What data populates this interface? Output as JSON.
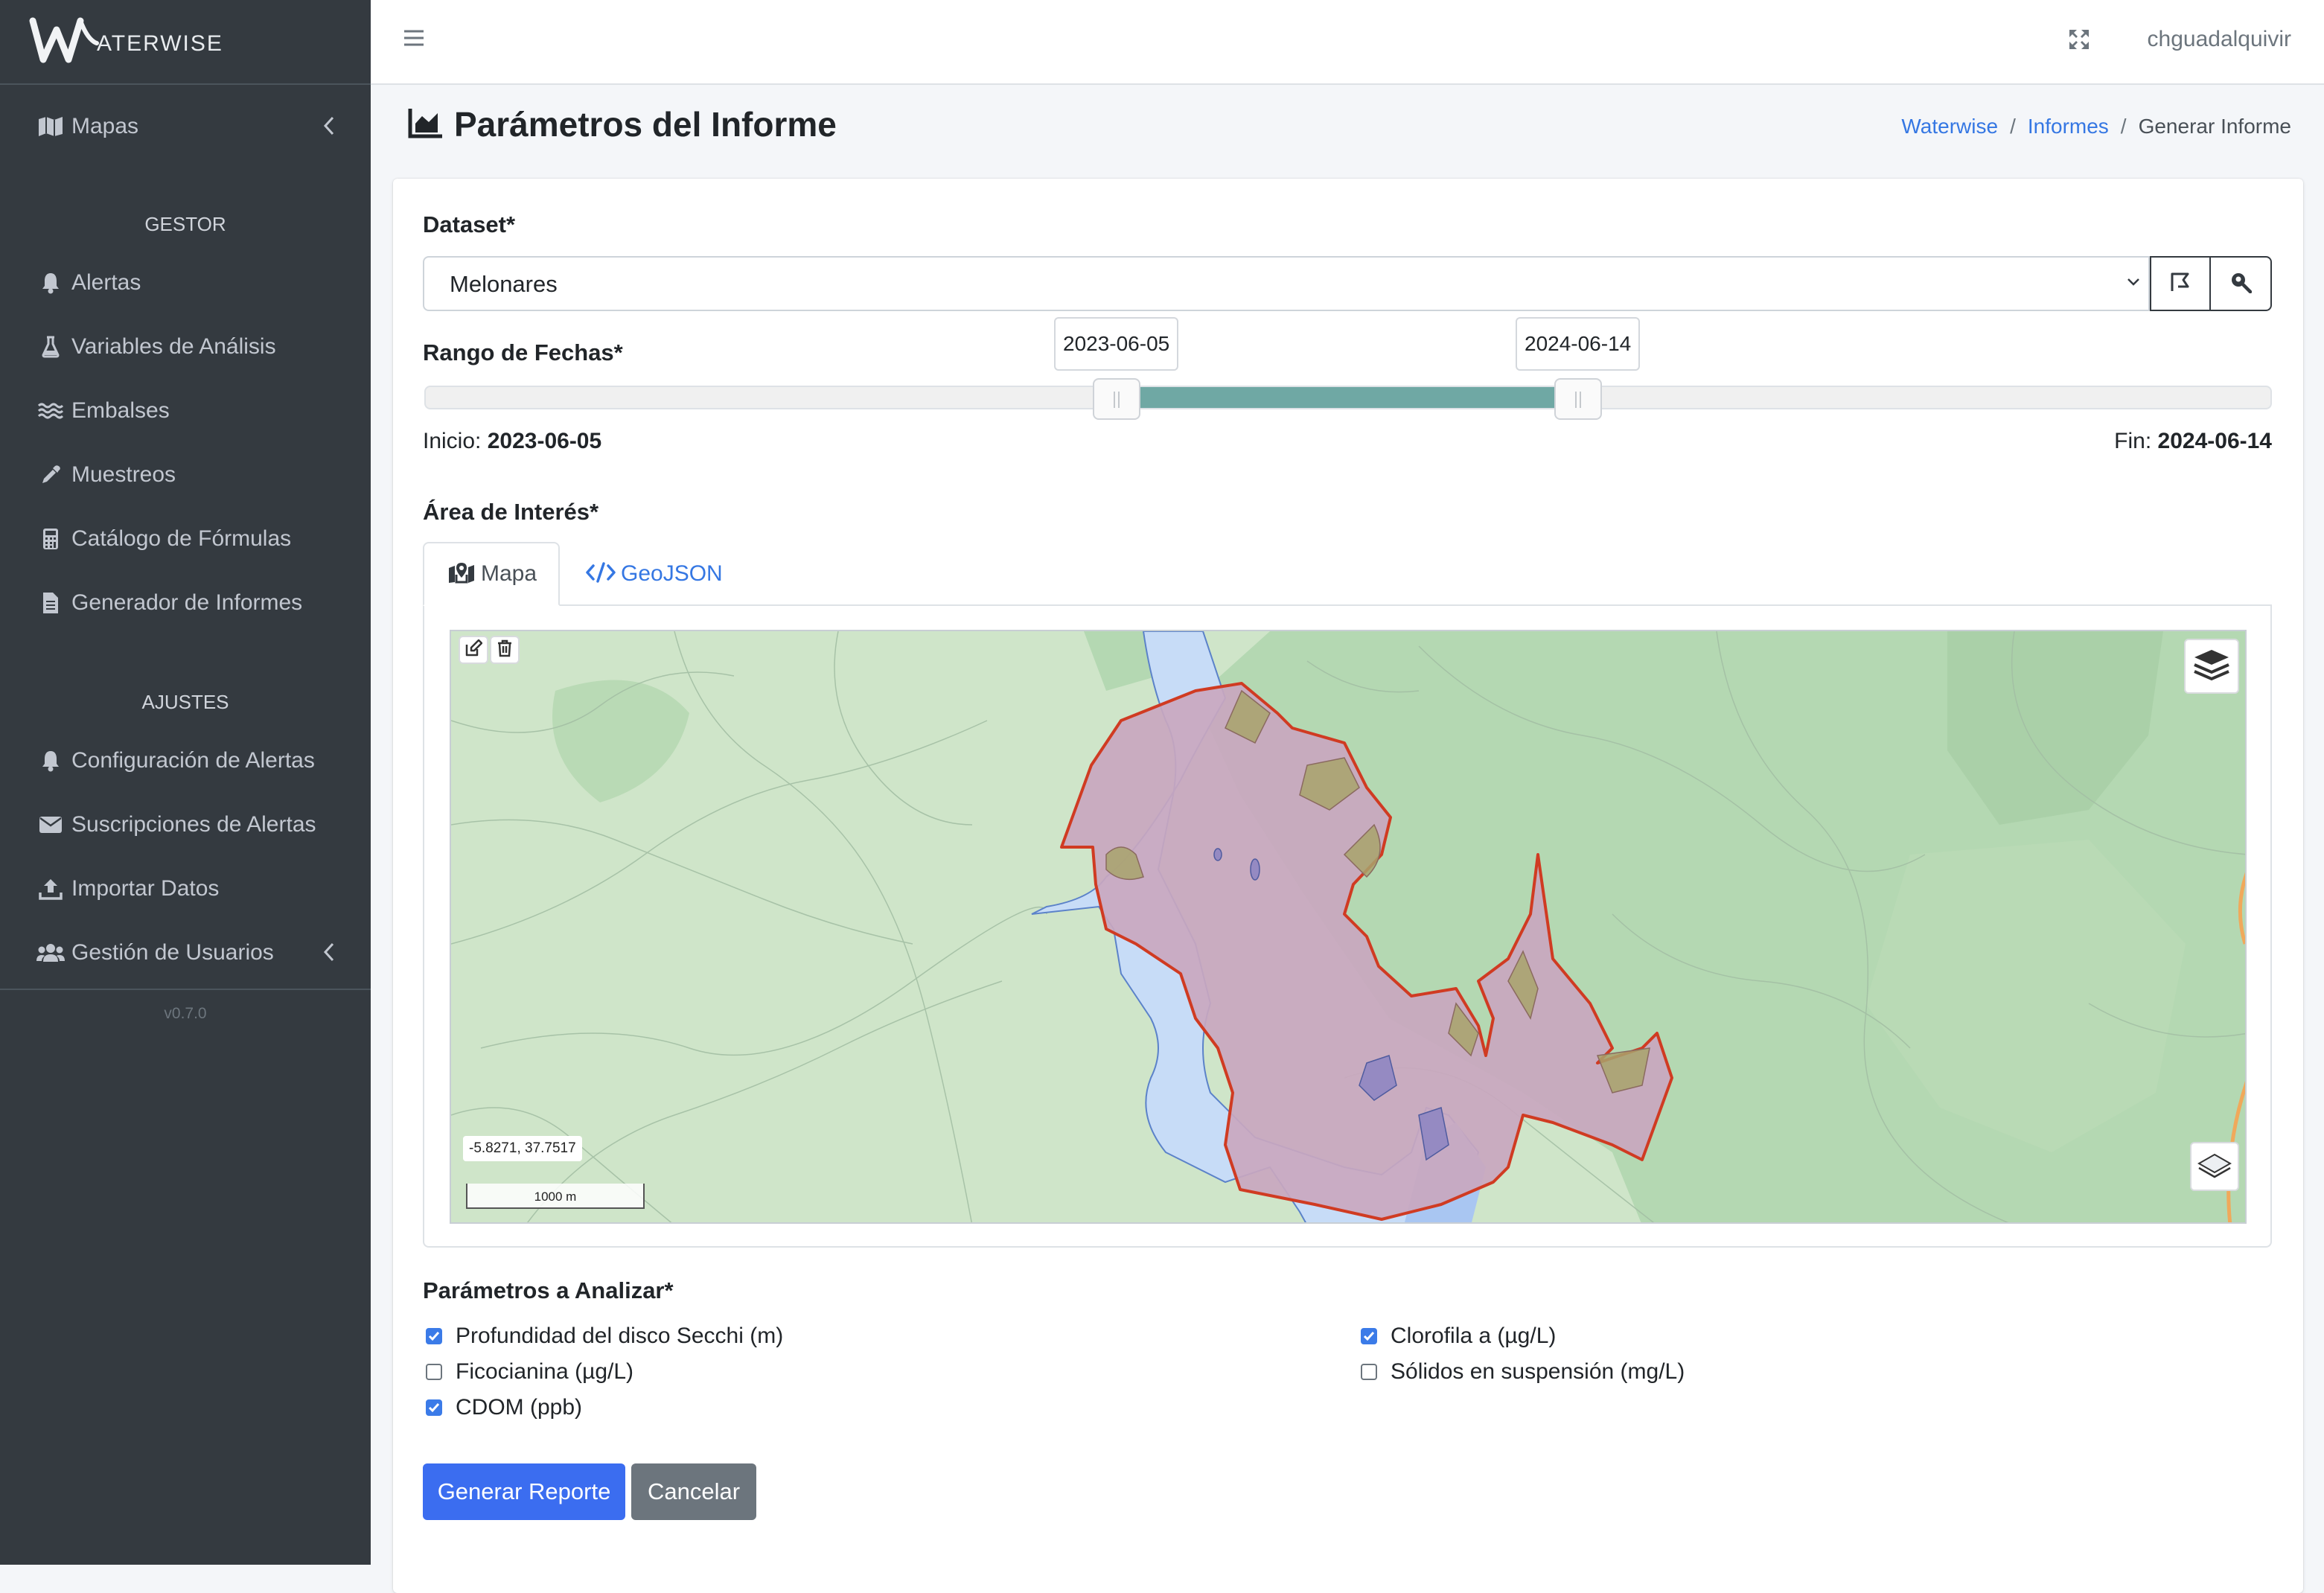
{
  "brand": {
    "logo_text": "ATERWISE"
  },
  "sidebar": {
    "maps": "Mapas",
    "section_gestor": "GESTOR",
    "items_gestor": [
      "Alertas",
      "Variables de Análisis",
      "Embalses",
      "Muestreos",
      "Catálogo de Fórmulas",
      "Generador de Informes"
    ],
    "section_ajustes": "AJUSTES",
    "items_ajustes": [
      "Configuración de Alertas",
      "Suscripciones de Alertas",
      "Importar Datos",
      "Gestión de Usuarios"
    ],
    "version": "v0.7.0"
  },
  "navbar": {
    "user": "chguadalquivir"
  },
  "header": {
    "title": "Parámetros del Informe",
    "breadcrumb": [
      "Waterwise",
      "Informes",
      "Generar Informe"
    ]
  },
  "form": {
    "dataset_label": "Dataset*",
    "dataset_value": "Melonares",
    "date_label": "Rango de Fechas*",
    "start_tooltip": "2023-06-05",
    "end_tooltip": "2024-06-14",
    "range_start_fraction": 0.36,
    "range_end_fraction": 0.61,
    "inicio_label": "Inicio:",
    "inicio_value": "2023-06-05",
    "fin_label": "Fin:",
    "fin_value": "2024-06-14",
    "area_label": "Área de Interés*",
    "tabs": [
      "Mapa",
      "GeoJSON"
    ],
    "params_label": "Parámetros a Analizar*",
    "params": [
      {
        "label": "Profundidad del disco Secchi (m)",
        "checked": true
      },
      {
        "label": "Clorofila a (µg/L)",
        "checked": true
      },
      {
        "label": "Ficocianina (µg/L)",
        "checked": false
      },
      {
        "label": "Sólidos en suspensión (mg/L)",
        "checked": false
      },
      {
        "label": "CDOM (ppb)",
        "checked": true
      }
    ],
    "submit": "Generar Reporte",
    "cancel": "Cancelar"
  },
  "map": {
    "coords": "-5.8271, 37.7517",
    "scale": "1000 m",
    "colors": {
      "land": "#cfe5c9",
      "forest": "#b4d8b2",
      "water": "#c7dcf7",
      "polygon_fill": "#c9a7bf",
      "polygon_stroke": "#d03b22"
    }
  },
  "colors": {
    "sidebar": "#343a40",
    "primary": "#3b6df0",
    "range": "#6fa8a4"
  }
}
